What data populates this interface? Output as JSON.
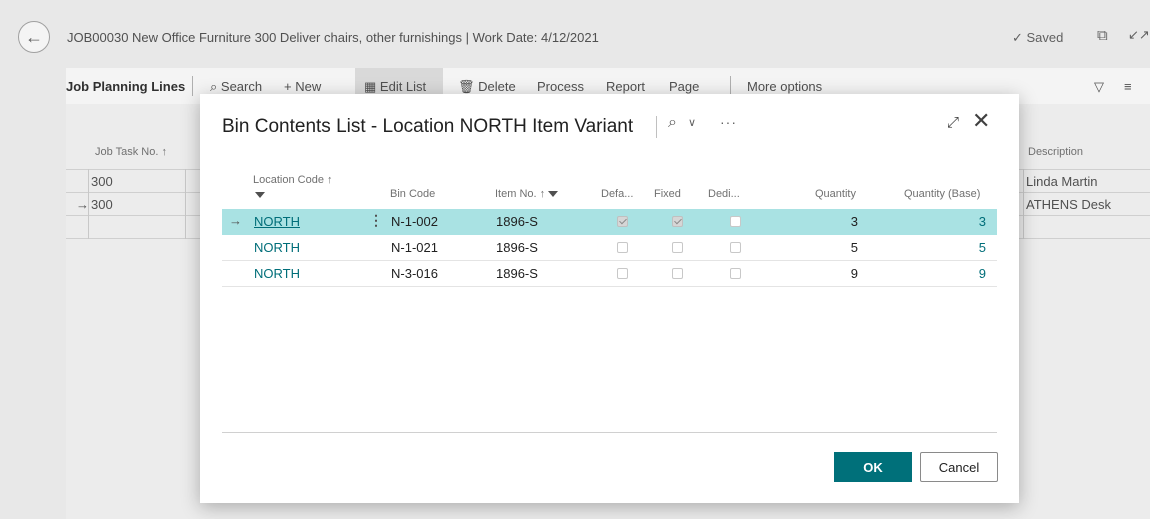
{
  "page": {
    "title": "JOB00030 New Office Furniture 300 Deliver chairs, other furnishings | Work Date: 4/12/2021",
    "saved_label": "Saved",
    "back_icon": "back-arrow-icon"
  },
  "card": {
    "title": "Job Planning Lines",
    "actions": {
      "search": "Search",
      "new": "New",
      "edit_list": "Edit List",
      "delete": "Delete",
      "process": "Process",
      "report": "Report",
      "page": "Page",
      "more_options": "More options"
    },
    "columns": {
      "job_task_no": "Job Task No. ↑",
      "description": "Description"
    },
    "rows": [
      {
        "job_task_no": "300",
        "description": "Linda Martin"
      },
      {
        "job_task_no": "300",
        "description": "ATHENS Desk"
      }
    ]
  },
  "dialog": {
    "title": "Bin Contents List - Location NORTH Item Variant",
    "columns": {
      "location_code": "Location Code ↑",
      "bin_code": "Bin Code",
      "item_no": "Item No. ↑",
      "default": "Defa...",
      "fixed": "Fixed",
      "dedicated": "Dedi...",
      "quantity": "Quantity",
      "quantity_base": "Quantity (Base)"
    },
    "rows": [
      {
        "location_code": "NORTH",
        "bin_code": "N-1-002",
        "item_no": "1896-S",
        "default": true,
        "fixed": true,
        "dedicated": false,
        "quantity": "3",
        "quantity_base": "3"
      },
      {
        "location_code": "NORTH",
        "bin_code": "N-1-021",
        "item_no": "1896-S",
        "default": false,
        "fixed": false,
        "dedicated": false,
        "quantity": "5",
        "quantity_base": "5"
      },
      {
        "location_code": "NORTH",
        "bin_code": "N-3-016",
        "item_no": "1896-S",
        "default": false,
        "fixed": false,
        "dedicated": false,
        "quantity": "9",
        "quantity_base": "9"
      }
    ],
    "ok_label": "OK",
    "cancel_label": "Cancel"
  },
  "colors": {
    "accent": "#00707a",
    "link": "#006e79",
    "selected_row": "#a9e2e3"
  }
}
